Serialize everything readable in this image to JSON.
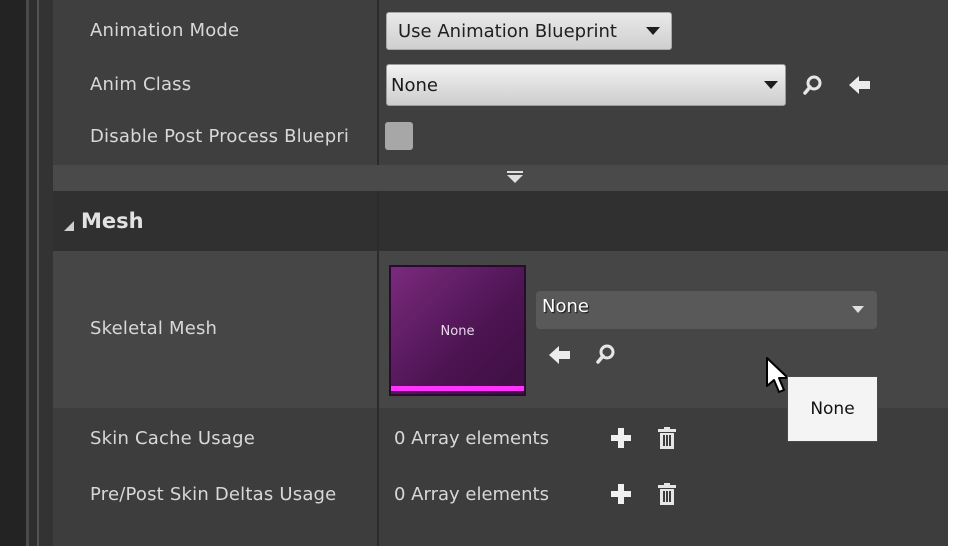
{
  "properties": {
    "animation_mode": {
      "label": "Animation Mode",
      "value": "Use Animation Blueprint"
    },
    "anim_class": {
      "label": "Anim Class",
      "value": "None"
    },
    "disable_post_process": {
      "label": "Disable Post Process Bluepri",
      "checked": false
    }
  },
  "mesh_section": {
    "title": "Mesh",
    "skeletal_mesh": {
      "label": "Skeletal Mesh",
      "thumbnail_text": "None",
      "value": "None",
      "thumbnail_color": "#4c1451",
      "thumbnail_bar_color": "#ff32ff"
    },
    "skin_cache_usage": {
      "label": "Skin Cache Usage",
      "value": "0 Array elements"
    },
    "pre_post_skin_deltas": {
      "label": "Pre/Post Skin Deltas Usage",
      "value": "0 Array elements"
    }
  },
  "tooltip": {
    "text": "None"
  },
  "icons": {
    "search": "magnifier-icon",
    "use_selected": "left-arrow-icon",
    "add": "plus-icon",
    "delete": "trash-icon",
    "expand": "chevron-down-icon",
    "collapse": "triangle-collapse-icon",
    "cursor": "mouse-pointer-icon"
  },
  "colors": {
    "panel_bg": "#3d3d3d",
    "section_header_bg": "#2f2f2f",
    "highlight_row_bg": "#464646",
    "text": "#d8d8d8"
  }
}
